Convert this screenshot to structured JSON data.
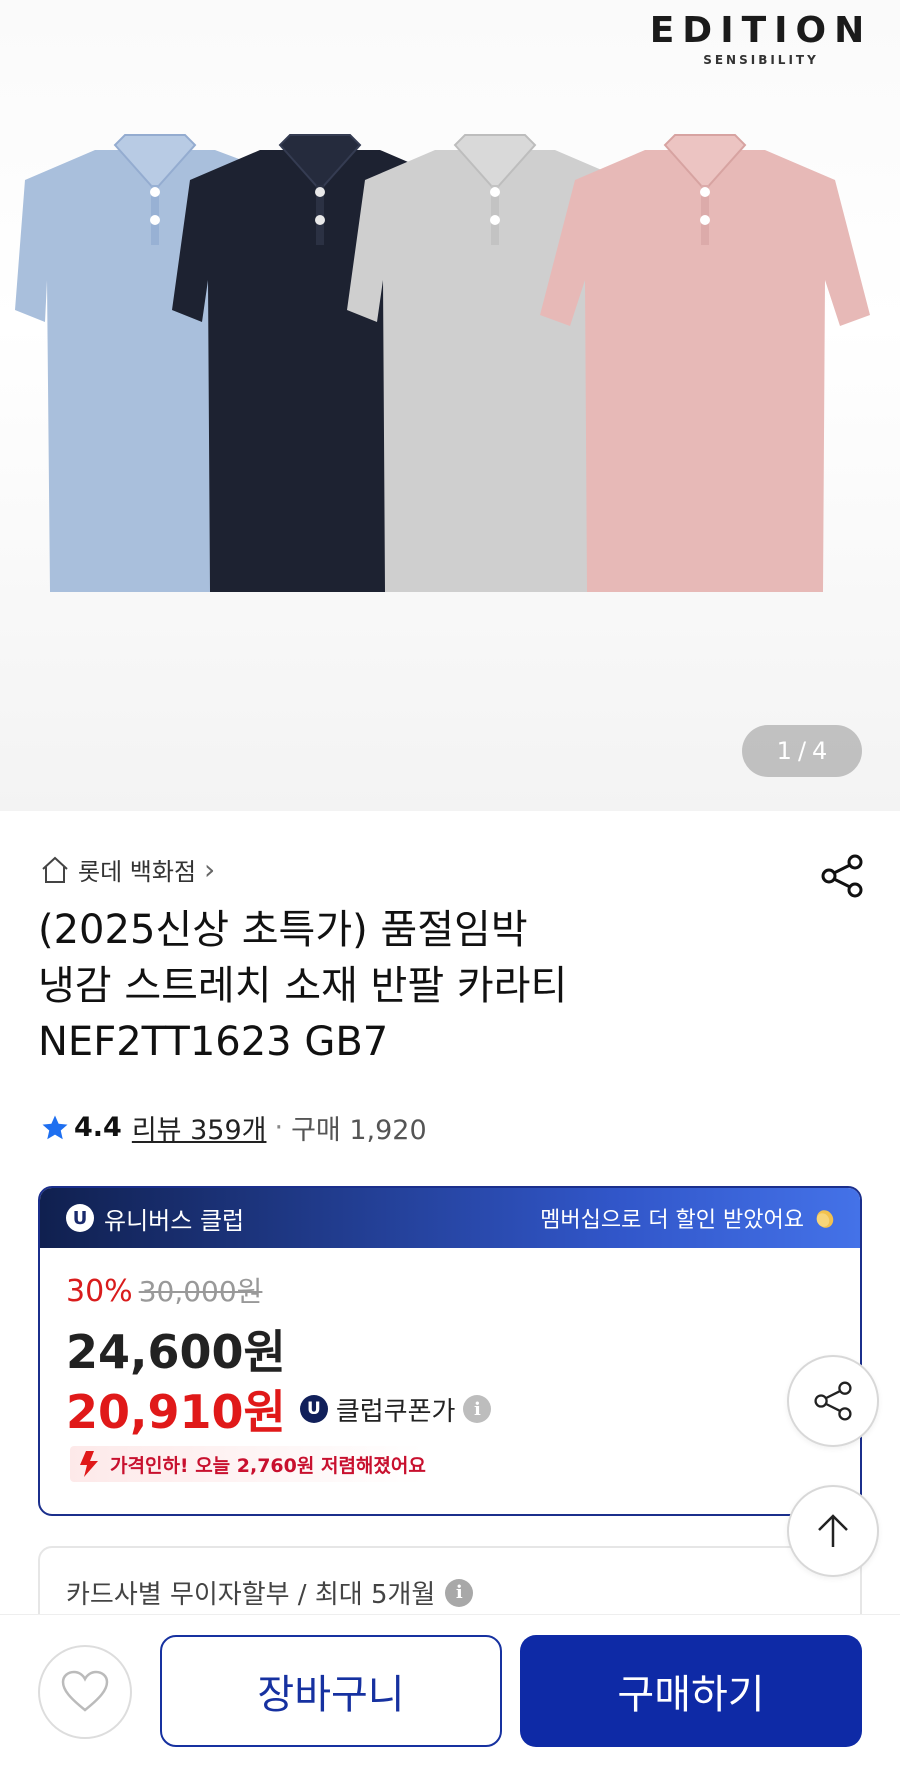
{
  "hero": {
    "brand_name": "EDITION",
    "brand_sub": "SENSIBILITY",
    "image_index": "1",
    "image_sep": "/",
    "image_total": "4",
    "shirt_colors": [
      "#a9bfdc",
      "#1d2231",
      "#cfcfcf",
      "#e7b9b7"
    ]
  },
  "seller": {
    "name": "롯데 백화점",
    "chevron": "›"
  },
  "product": {
    "title_line1": "(2025신상 초특가) 품절임박",
    "title_line2": "냉감 스트레치 소재 반팔 카라티",
    "title_line3": "NEF2TT1623 GB7"
  },
  "rating": {
    "score": "4.4",
    "review_label": "리뷰 359개",
    "separator": "·",
    "purchase_label": "구매 1,920"
  },
  "club": {
    "badge": "U",
    "name": "유니버스 클럽",
    "message": "멤버십으로 더 할인 받았어요"
  },
  "price": {
    "discount_pct": "30%",
    "original": "30,000원",
    "sale": "24,600원",
    "coupon_price": "20,910원",
    "coupon_badge": "U",
    "coupon_label": "클럽쿠폰가",
    "info": "i",
    "drop_message": "가격인하! 오늘 2,760원 저렴해졌어요"
  },
  "installment": {
    "text": "카드사별 무이자할부 / 최대 5개월",
    "info": "i"
  },
  "actions": {
    "cart_label": "장바구니",
    "buy_label": "구매하기"
  },
  "colors": {
    "brand_blue": "#0e2aa6",
    "discount_red": "#e01919",
    "star_blue": "#1e6ff0"
  }
}
